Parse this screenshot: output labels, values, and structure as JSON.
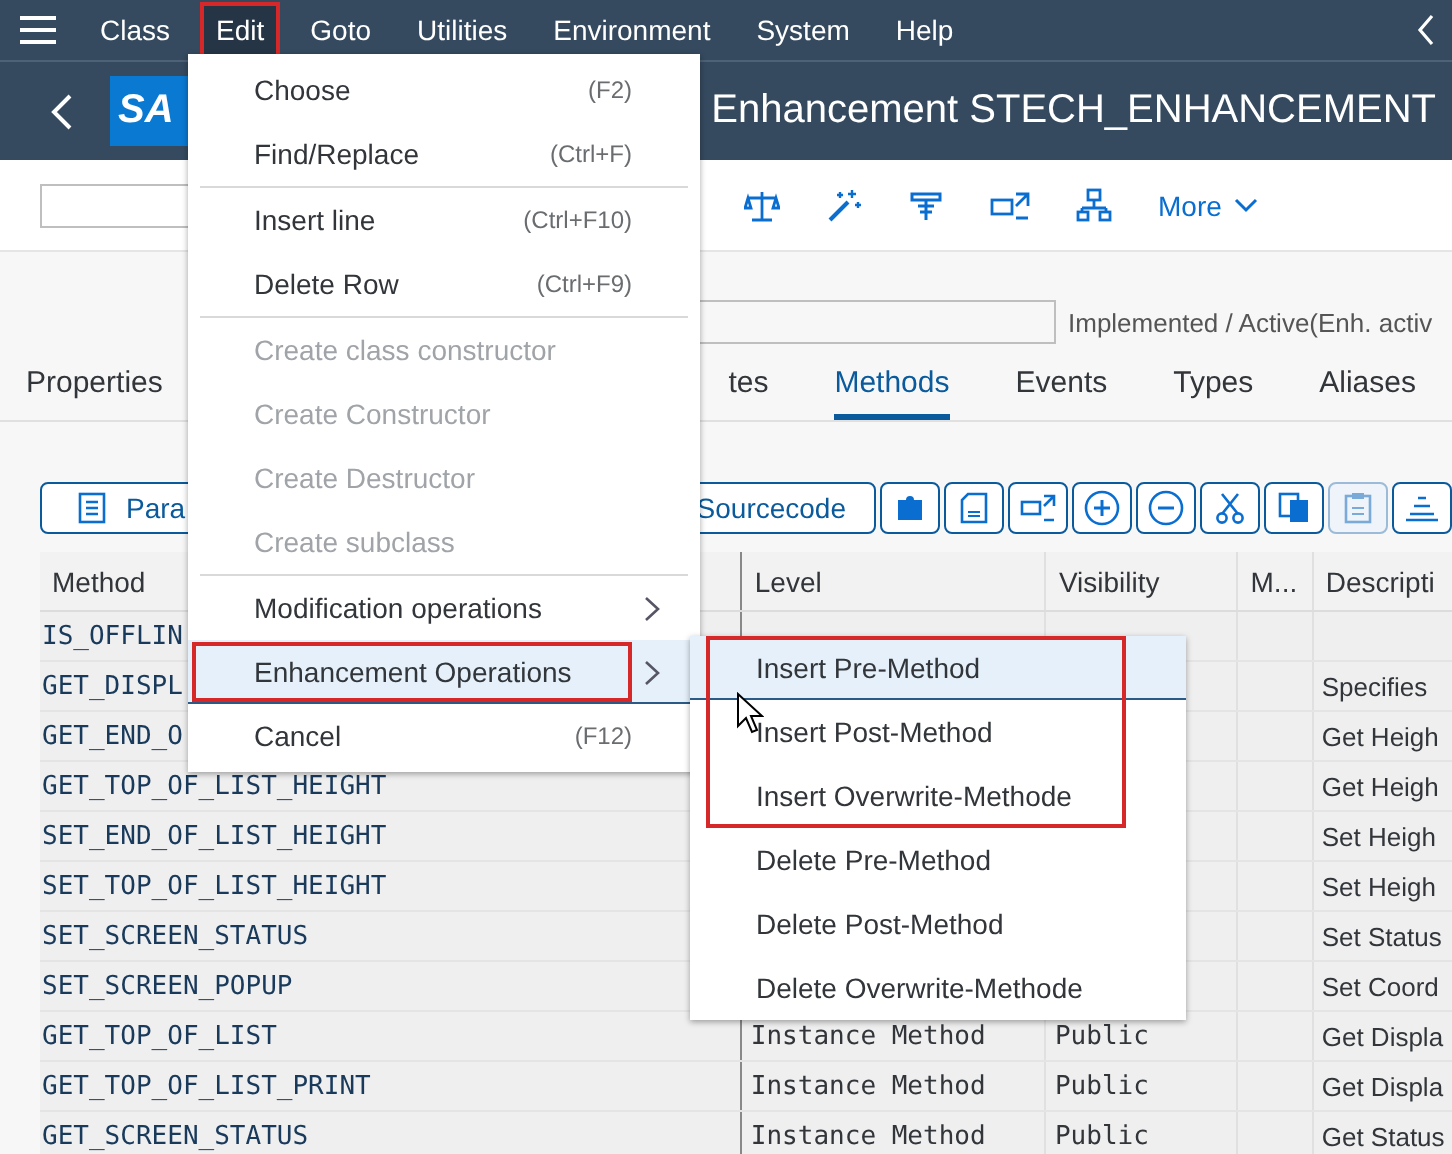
{
  "menu_bar": {
    "items": [
      {
        "label": "Class",
        "selected": false,
        "highlighted": false
      },
      {
        "label": "Edit",
        "selected": true,
        "highlighted": true
      },
      {
        "label": "Goto",
        "selected": false,
        "highlighted": false
      },
      {
        "label": "Utilities",
        "selected": false,
        "highlighted": false
      },
      {
        "label": "Environment",
        "selected": false,
        "highlighted": false
      },
      {
        "label": "System",
        "selected": false,
        "highlighted": false
      },
      {
        "label": "Help",
        "selected": false,
        "highlighted": false
      }
    ]
  },
  "title_bar": {
    "logo": "SA",
    "title": "Enhancement STECH_ENHANCEMENT"
  },
  "toolbar": {
    "more_label": "More"
  },
  "status_text": "Implemented / Active(Enh. activ",
  "tabs": [
    {
      "label": "Properties",
      "selected": false
    },
    {
      "label": "tes",
      "selected": false
    },
    {
      "label": "Methods",
      "selected": true
    },
    {
      "label": "Events",
      "selected": false
    },
    {
      "label": "Types",
      "selected": false
    },
    {
      "label": "Aliases",
      "selected": false
    }
  ],
  "table_toolbar": {
    "buttons": [
      {
        "label": "Para"
      },
      {
        "label": "Sourcecode"
      }
    ]
  },
  "table": {
    "columns": [
      "Method",
      "Level",
      "Visibility",
      "M...",
      "Descripti"
    ],
    "rows": [
      {
        "method": "IS_OFFLIN"
      },
      {
        "method": "GET_DISPL",
        "description": "Specifies"
      },
      {
        "method": "GET_END_O",
        "description": "Get Heigh"
      },
      {
        "method": "GET_TOP_OF_LIST_HEIGHT",
        "description": "Get Heigh"
      },
      {
        "method": "SET_END_OF_LIST_HEIGHT",
        "description": "Set Heigh"
      },
      {
        "method": "SET_TOP_OF_LIST_HEIGHT",
        "description": "Set Heigh"
      },
      {
        "method": "SET_SCREEN_STATUS",
        "description": "Set Status"
      },
      {
        "method": "SET_SCREEN_POPUP",
        "description": "Set Coord"
      },
      {
        "method": "GET_TOP_OF_LIST",
        "level": "Instance Method",
        "visibility": "Public",
        "description": "Get Displa"
      },
      {
        "method": "GET_TOP_OF_LIST_PRINT",
        "level": "Instance Method",
        "visibility": "Public",
        "description": "Get Displa"
      },
      {
        "method": "GET_SCREEN_STATUS",
        "level": "Instance Method",
        "visibility": "Public",
        "description": "Get Status"
      }
    ]
  },
  "edit_menu": {
    "items": [
      {
        "kind": "item",
        "label": "Choose",
        "shortcut": "(F2)",
        "disabled": false,
        "submenu": false,
        "selected": false,
        "highlighted": false
      },
      {
        "kind": "item",
        "label": "Find/Replace",
        "shortcut": "(Ctrl+F)",
        "disabled": false,
        "submenu": false,
        "selected": false,
        "highlighted": false
      },
      {
        "kind": "separator"
      },
      {
        "kind": "item",
        "label": "Insert line",
        "shortcut": "(Ctrl+F10)",
        "disabled": false,
        "submenu": false,
        "selected": false,
        "highlighted": false
      },
      {
        "kind": "item",
        "label": "Delete Row",
        "shortcut": "(Ctrl+F9)",
        "disabled": false,
        "submenu": false,
        "selected": false,
        "highlighted": false
      },
      {
        "kind": "separator"
      },
      {
        "kind": "item",
        "label": "Create class constructor",
        "disabled": true,
        "submenu": false,
        "selected": false,
        "highlighted": false
      },
      {
        "kind": "item",
        "label": "Create Constructor",
        "disabled": true,
        "submenu": false,
        "selected": false,
        "highlighted": false
      },
      {
        "kind": "item",
        "label": "Create Destructor",
        "disabled": true,
        "submenu": false,
        "selected": false,
        "highlighted": false
      },
      {
        "kind": "item",
        "label": "Create subclass",
        "disabled": true,
        "submenu": false,
        "selected": false,
        "highlighted": false
      },
      {
        "kind": "separator"
      },
      {
        "kind": "item",
        "label": "Modification operations",
        "disabled": false,
        "submenu": true,
        "selected": false,
        "highlighted": false
      },
      {
        "kind": "item",
        "label": "Enhancement Operations",
        "disabled": false,
        "submenu": true,
        "selected": true,
        "highlighted": true
      },
      {
        "kind": "item",
        "label": "Cancel",
        "shortcut": "(F12)",
        "disabled": false,
        "submenu": false,
        "selected": false,
        "highlighted": false
      }
    ]
  },
  "submenu": {
    "items": [
      {
        "label": "Insert Pre-Method",
        "selected": true,
        "highlighted": true
      },
      {
        "label": "Insert Post-Method",
        "selected": false,
        "highlighted": true
      },
      {
        "label": "Insert Overwrite-Methode",
        "selected": false,
        "highlighted": true
      },
      {
        "label": "Delete Pre-Method",
        "selected": false,
        "highlighted": false
      },
      {
        "label": "Delete Post-Method",
        "selected": false,
        "highlighted": false
      },
      {
        "label": "Delete Overwrite-Methode",
        "selected": false,
        "highlighted": false
      }
    ]
  }
}
